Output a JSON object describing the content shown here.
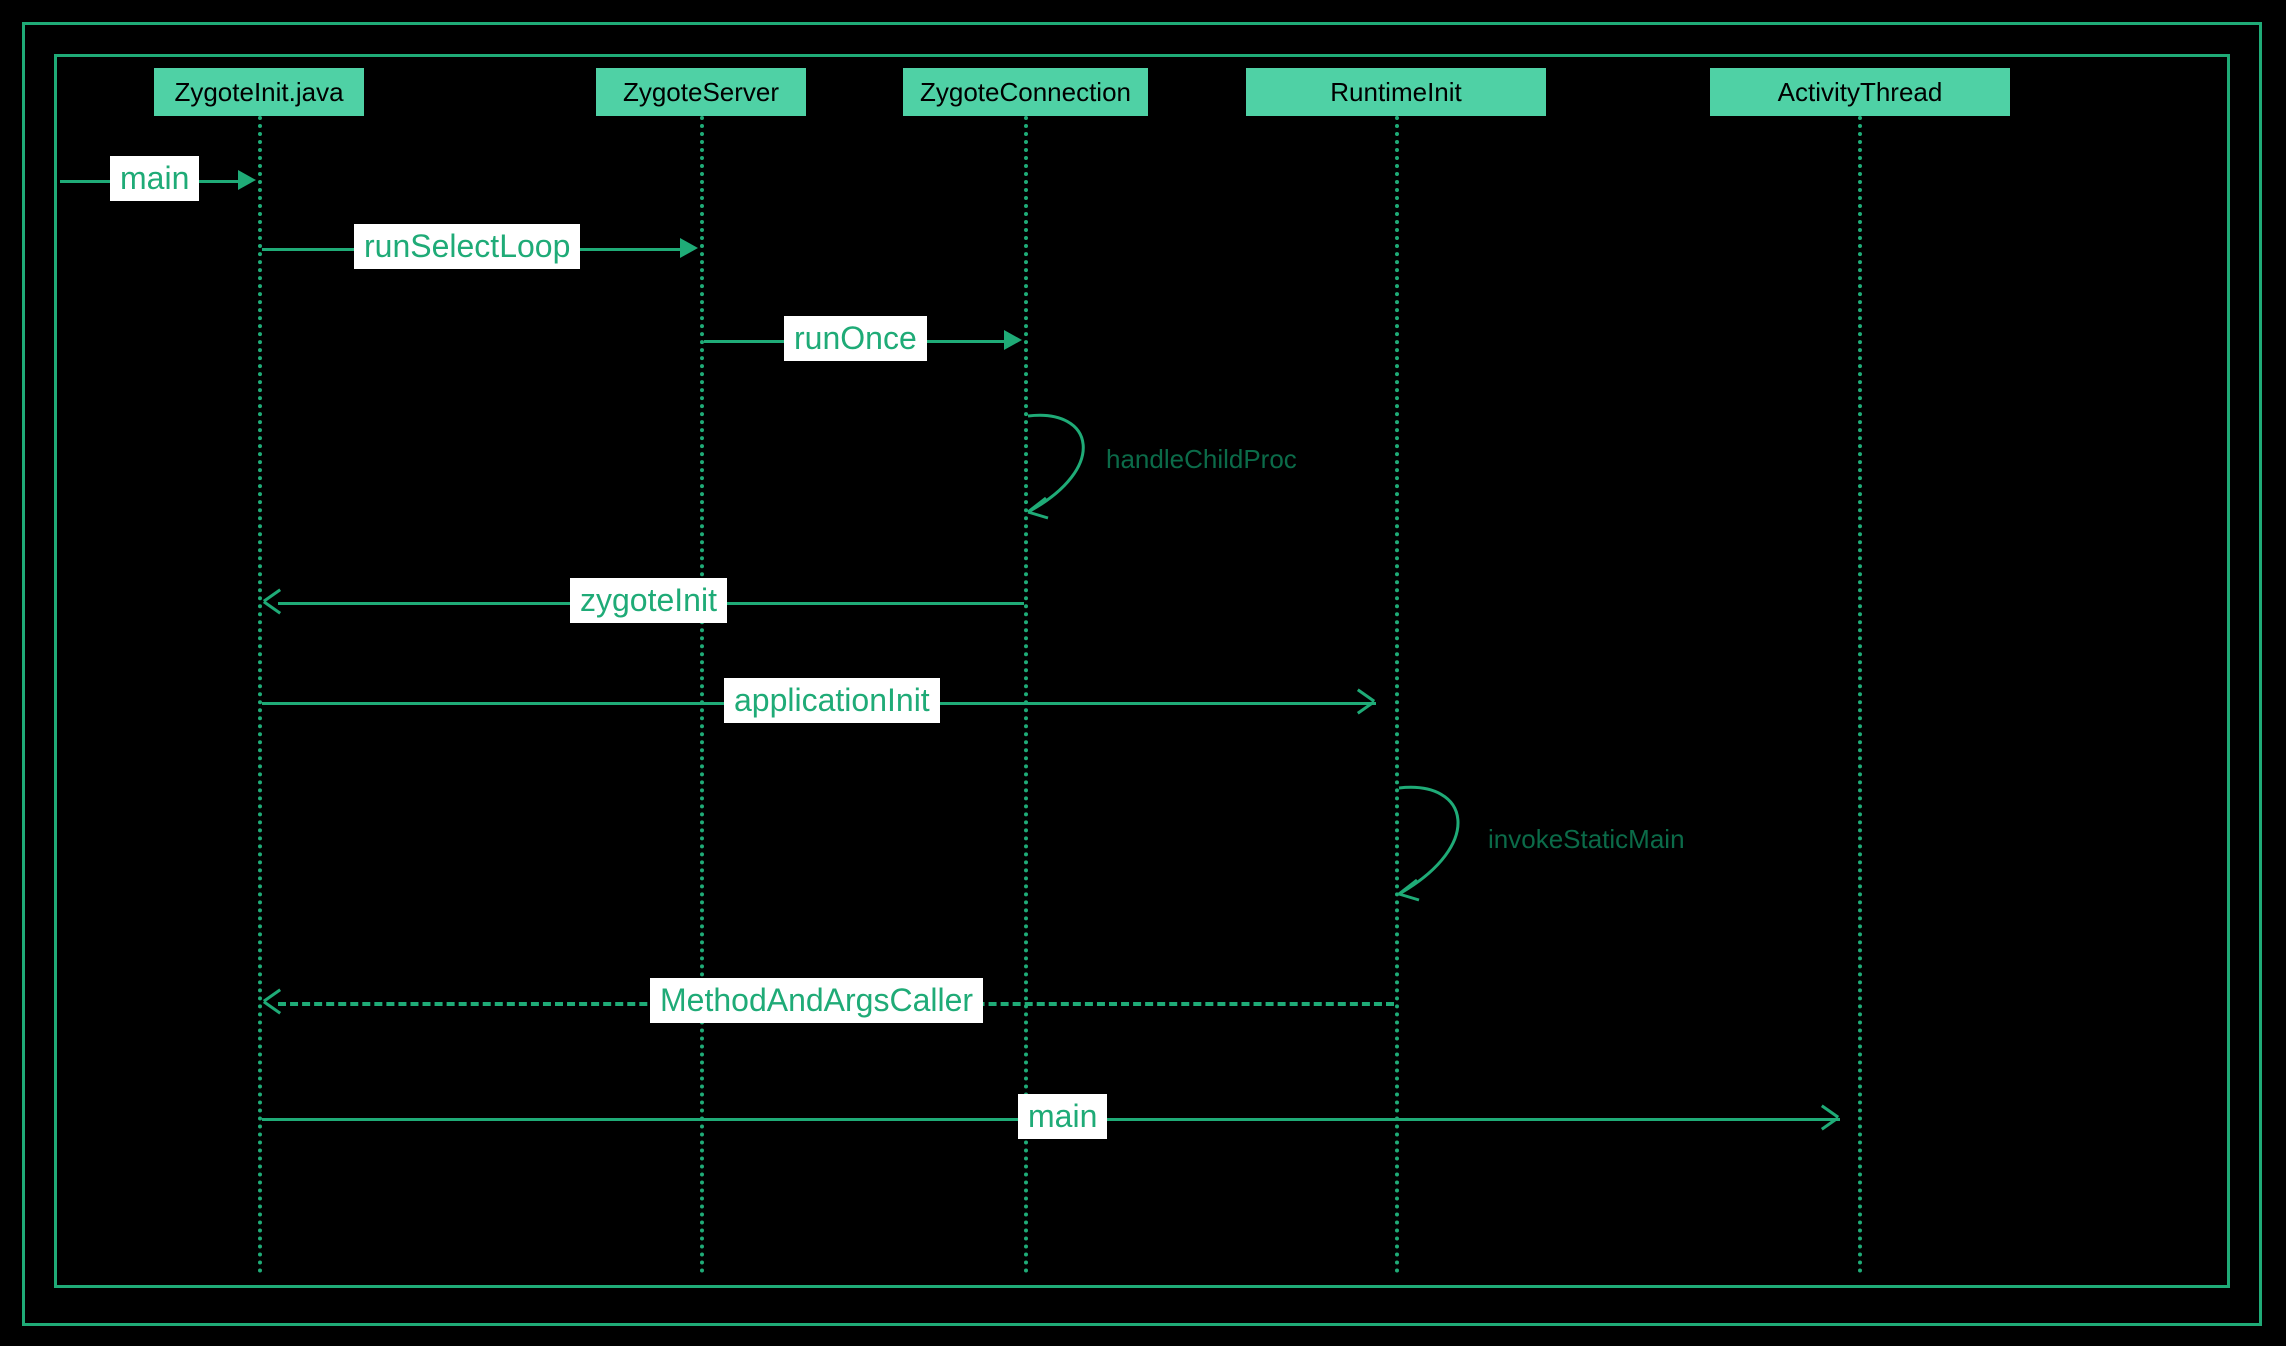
{
  "participants": {
    "p1": "ZygoteInit.java",
    "p2": "ZygoteServer",
    "p3": "ZygoteConnection",
    "p4": "RuntimeInit",
    "p5": "ActivityThread"
  },
  "messages": {
    "m1": "main",
    "m2": "runSelectLoop",
    "m3": "runOnce",
    "m4": "handleChildProc",
    "m5": "zygoteInit",
    "m6": "applicationInit",
    "m7": "invokeStaticMain",
    "m8": "MethodAndArgsCaller",
    "m9": "main"
  },
  "colors": {
    "bg": "#000000",
    "line": "#1fab77",
    "box": "#4fd1a5",
    "label_bg": "#ffffff",
    "label_fg": "#1fab77",
    "self_fg": "#0b6b49"
  }
}
